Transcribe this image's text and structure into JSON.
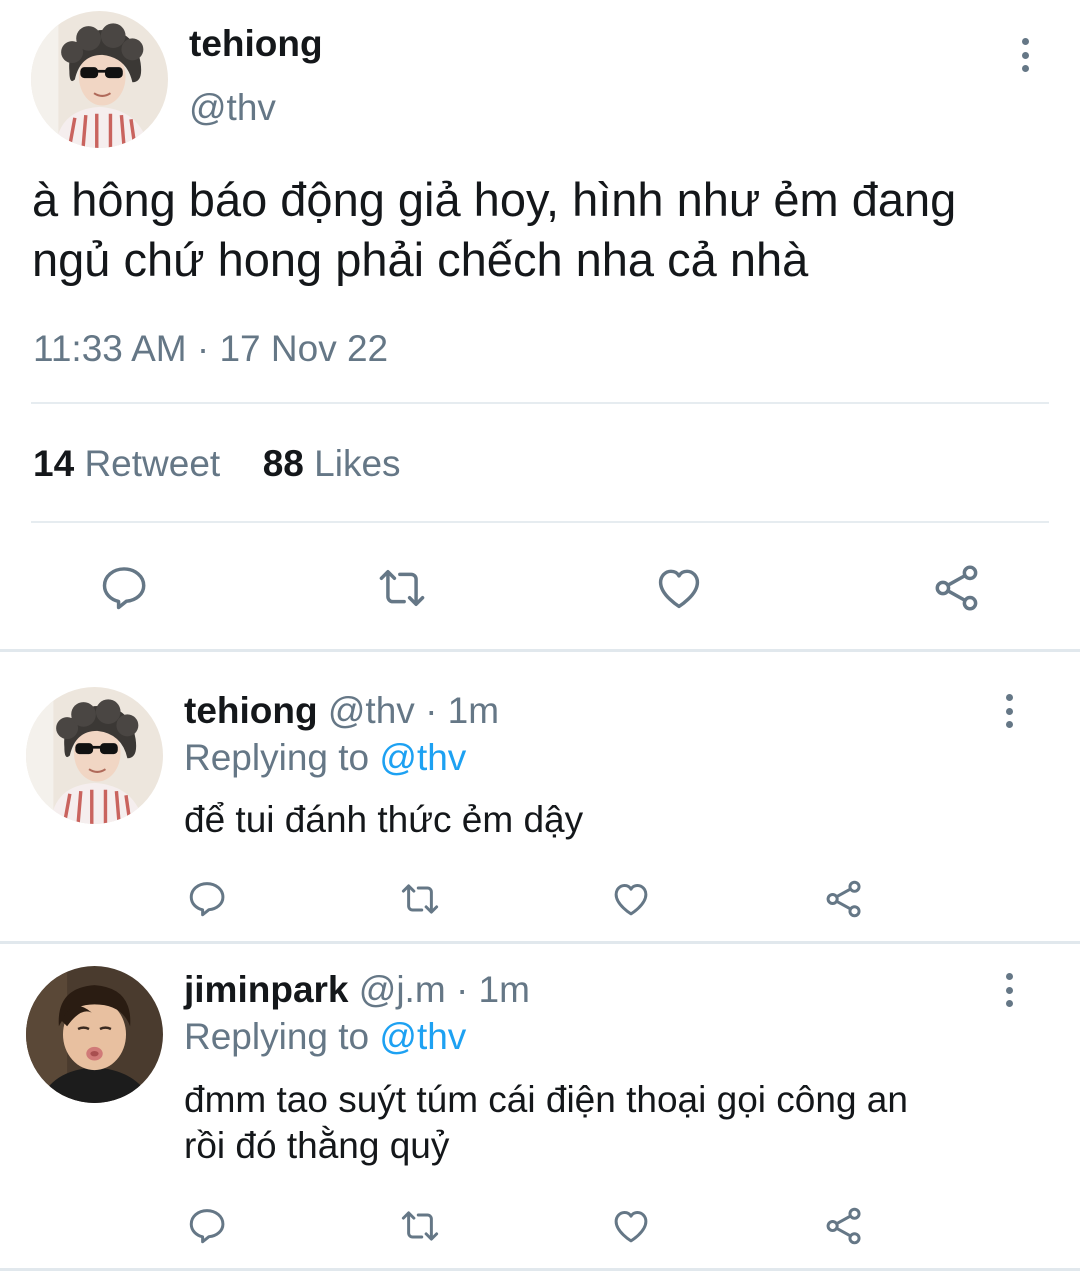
{
  "main_tweet": {
    "display_name": "tehiong",
    "handle": "@thv",
    "text_line1": "à hông báo động giả hoy, hình như ẻm đang",
    "text_line2": "ngủ chứ hong phải chếch nha cả nhà",
    "timestamp": "11:33 AM · 17 Nov 22",
    "retweet_count": "14",
    "retweet_label": "Retweet",
    "like_count": "88",
    "like_label": "Likes"
  },
  "replies": [
    {
      "display_name": "tehiong",
      "handle": "@thv",
      "time": "· 1m",
      "replying_prefix": "Replying to",
      "replying_handle": "@thv",
      "text_line1": "để tui đánh thức ẻm dậy",
      "text_line2": ""
    },
    {
      "display_name": "jiminpark",
      "handle": "@j.m",
      "time": "· 1m",
      "replying_prefix": "Replying to",
      "replying_handle": "@thv",
      "text_line1": "đmm tao suýt túm cái điện thoại gọi công an",
      "text_line2": "rồi đó thằng quỷ"
    }
  ],
  "icons": {
    "reply": "reply-icon",
    "retweet": "retweet-icon",
    "like": "heart-icon",
    "share": "share-icon",
    "more": "more-vertical-icon"
  },
  "colors": {
    "text": "#14171a",
    "secondary": "#657786",
    "link": "#1da1f2",
    "divider": "#e6ecf0"
  }
}
